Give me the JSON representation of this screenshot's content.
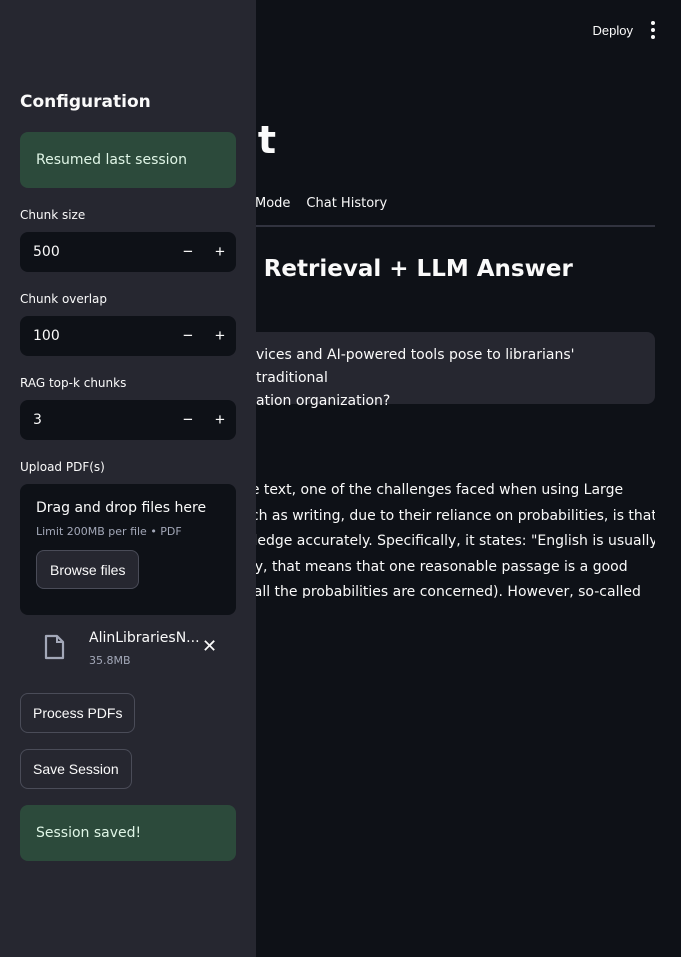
{
  "header": {
    "deploy_label": "Deploy",
    "menu_icon": "kebab-menu-icon"
  },
  "main": {
    "title": "nt",
    "tabs": [
      {
        "label": "Mode"
      },
      {
        "label": "Chat History"
      }
    ],
    "section_title": "F Retrieval + LLM Answer",
    "question_lines": [
      "vices and AI-powered tools pose to librarians' traditional",
      "ation organization?"
    ],
    "answer_lines": [
      "ne text, one of the challenges faced when using Large",
      "uch as writing, due to their reliance on probabilities, is that",
      "wledge accurately. Specifically, it states: \"English is usually",
      "hly, that means that one reasonable passage is a good",
      "s all the probabilities are concerned). However, so-called"
    ]
  },
  "sidebar": {
    "title": "Configuration",
    "resumed_msg": "Resumed last session",
    "chunk_size": {
      "label": "Chunk size",
      "value": "500"
    },
    "chunk_overlap": {
      "label": "Chunk overlap",
      "value": "100"
    },
    "top_k": {
      "label": "RAG top-k chunks",
      "value": "3"
    },
    "minus": "−",
    "plus": "+",
    "upload": {
      "label": "Upload PDF(s)",
      "drop_text": "Drag and drop files here",
      "limit": "Limit 200MB per file • PDF",
      "browse": "Browse files"
    },
    "file": {
      "name": "AlinLibrariesN...",
      "size": "35.8MB"
    },
    "process_label": "Process PDFs",
    "save_label": "Save Session",
    "saved_msg": "Session saved!"
  },
  "colors": {
    "sidebar": "#262730",
    "main": "#0e1117",
    "success": "#2c4a3b"
  }
}
